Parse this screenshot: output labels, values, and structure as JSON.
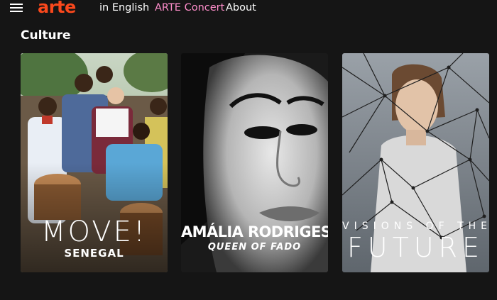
{
  "nav": {
    "logo": "arte",
    "links": [
      "in English",
      "ARTE Concert",
      "About"
    ],
    "concert_color": "#ff8ecb",
    "logo_color": "#fa481c"
  },
  "section": {
    "title": "Culture"
  },
  "cards": [
    {
      "title": "MOVE!",
      "subtitle": "SENEGAL"
    },
    {
      "title": "AMÁLIA RODRIGES",
      "subtitle": "QUEEN OF FADO"
    },
    {
      "title": "VISIONS OF THE",
      "subtitle": "FUTURE"
    }
  ]
}
